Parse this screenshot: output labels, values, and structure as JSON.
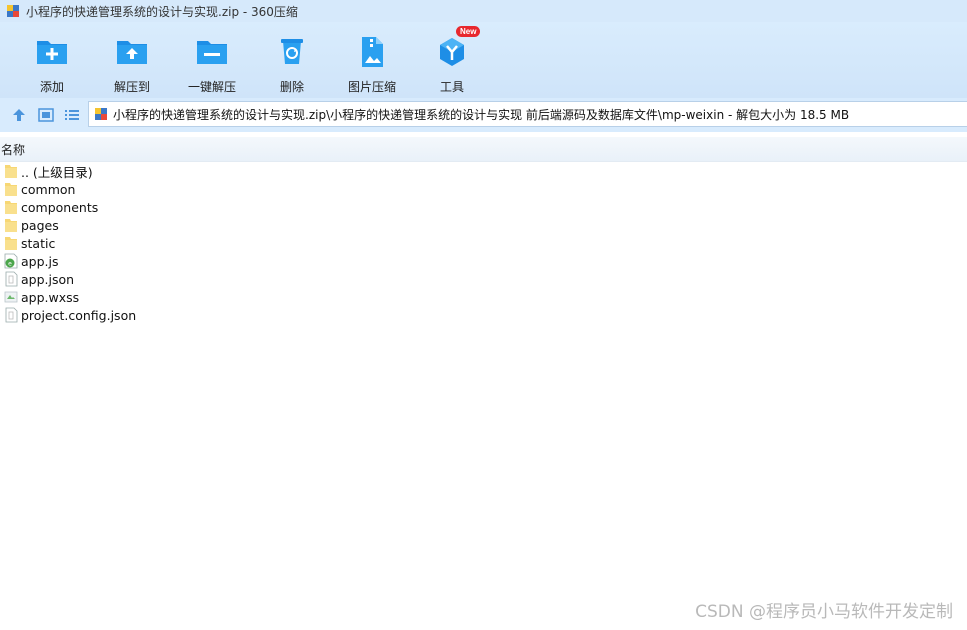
{
  "window": {
    "title": "小程序的快递管理系统的设计与实现.zip - 360压缩",
    "app_icon": "archive-icon"
  },
  "toolbar": {
    "items": [
      {
        "label": "添加",
        "icon": "add-folder-icon"
      },
      {
        "label": "解压到",
        "icon": "extract-folder-icon"
      },
      {
        "label": "一键解压",
        "icon": "one-click-extract-icon"
      },
      {
        "label": "删除",
        "icon": "recycle-bin-icon"
      },
      {
        "label": "图片压缩",
        "icon": "image-compress-icon"
      },
      {
        "label": "工具",
        "icon": "tools-hexagon-icon",
        "badge": "New"
      }
    ]
  },
  "address": {
    "path": "小程序的快递管理系统的设计与实现.zip\\小程序的快递管理系统的设计与实现 前后端源码及数据库文件\\mp-weixin - 解包大小为 18.5 MB"
  },
  "columns": {
    "name": "名称"
  },
  "files": [
    {
      "name": ".. (上级目录)",
      "type": "folder"
    },
    {
      "name": "common",
      "type": "folder"
    },
    {
      "name": "components",
      "type": "folder"
    },
    {
      "name": "pages",
      "type": "folder"
    },
    {
      "name": "static",
      "type": "folder"
    },
    {
      "name": "app.js",
      "type": "js"
    },
    {
      "name": "app.json",
      "type": "json"
    },
    {
      "name": "app.wxss",
      "type": "wxss"
    },
    {
      "name": "project.config.json",
      "type": "json"
    }
  ],
  "watermark": "CSDN @程序员小马软件开发定制",
  "colors": {
    "toolbar_bg": "#d6e9fb",
    "icon_blue": "#1e8ee6",
    "folder_yellow": "#f7d774",
    "badge_red": "#e8282e"
  }
}
